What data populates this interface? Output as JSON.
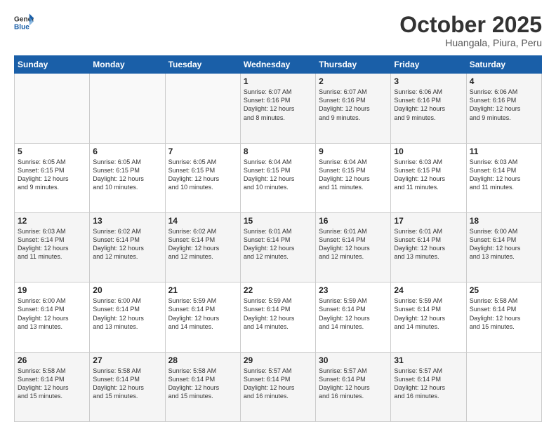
{
  "header": {
    "logo_line1": "General",
    "logo_line2": "Blue",
    "month": "October 2025",
    "location": "Huangala, Piura, Peru"
  },
  "weekdays": [
    "Sunday",
    "Monday",
    "Tuesday",
    "Wednesday",
    "Thursday",
    "Friday",
    "Saturday"
  ],
  "rows": [
    [
      {
        "day": "",
        "lines": []
      },
      {
        "day": "",
        "lines": []
      },
      {
        "day": "",
        "lines": []
      },
      {
        "day": "1",
        "lines": [
          "Sunrise: 6:07 AM",
          "Sunset: 6:16 PM",
          "Daylight: 12 hours",
          "and 8 minutes."
        ]
      },
      {
        "day": "2",
        "lines": [
          "Sunrise: 6:07 AM",
          "Sunset: 6:16 PM",
          "Daylight: 12 hours",
          "and 9 minutes."
        ]
      },
      {
        "day": "3",
        "lines": [
          "Sunrise: 6:06 AM",
          "Sunset: 6:16 PM",
          "Daylight: 12 hours",
          "and 9 minutes."
        ]
      },
      {
        "day": "4",
        "lines": [
          "Sunrise: 6:06 AM",
          "Sunset: 6:16 PM",
          "Daylight: 12 hours",
          "and 9 minutes."
        ]
      }
    ],
    [
      {
        "day": "5",
        "lines": [
          "Sunrise: 6:05 AM",
          "Sunset: 6:15 PM",
          "Daylight: 12 hours",
          "and 9 minutes."
        ]
      },
      {
        "day": "6",
        "lines": [
          "Sunrise: 6:05 AM",
          "Sunset: 6:15 PM",
          "Daylight: 12 hours",
          "and 10 minutes."
        ]
      },
      {
        "day": "7",
        "lines": [
          "Sunrise: 6:05 AM",
          "Sunset: 6:15 PM",
          "Daylight: 12 hours",
          "and 10 minutes."
        ]
      },
      {
        "day": "8",
        "lines": [
          "Sunrise: 6:04 AM",
          "Sunset: 6:15 PM",
          "Daylight: 12 hours",
          "and 10 minutes."
        ]
      },
      {
        "day": "9",
        "lines": [
          "Sunrise: 6:04 AM",
          "Sunset: 6:15 PM",
          "Daylight: 12 hours",
          "and 11 minutes."
        ]
      },
      {
        "day": "10",
        "lines": [
          "Sunrise: 6:03 AM",
          "Sunset: 6:15 PM",
          "Daylight: 12 hours",
          "and 11 minutes."
        ]
      },
      {
        "day": "11",
        "lines": [
          "Sunrise: 6:03 AM",
          "Sunset: 6:14 PM",
          "Daylight: 12 hours",
          "and 11 minutes."
        ]
      }
    ],
    [
      {
        "day": "12",
        "lines": [
          "Sunrise: 6:03 AM",
          "Sunset: 6:14 PM",
          "Daylight: 12 hours",
          "and 11 minutes."
        ]
      },
      {
        "day": "13",
        "lines": [
          "Sunrise: 6:02 AM",
          "Sunset: 6:14 PM",
          "Daylight: 12 hours",
          "and 12 minutes."
        ]
      },
      {
        "day": "14",
        "lines": [
          "Sunrise: 6:02 AM",
          "Sunset: 6:14 PM",
          "Daylight: 12 hours",
          "and 12 minutes."
        ]
      },
      {
        "day": "15",
        "lines": [
          "Sunrise: 6:01 AM",
          "Sunset: 6:14 PM",
          "Daylight: 12 hours",
          "and 12 minutes."
        ]
      },
      {
        "day": "16",
        "lines": [
          "Sunrise: 6:01 AM",
          "Sunset: 6:14 PM",
          "Daylight: 12 hours",
          "and 12 minutes."
        ]
      },
      {
        "day": "17",
        "lines": [
          "Sunrise: 6:01 AM",
          "Sunset: 6:14 PM",
          "Daylight: 12 hours",
          "and 13 minutes."
        ]
      },
      {
        "day": "18",
        "lines": [
          "Sunrise: 6:00 AM",
          "Sunset: 6:14 PM",
          "Daylight: 12 hours",
          "and 13 minutes."
        ]
      }
    ],
    [
      {
        "day": "19",
        "lines": [
          "Sunrise: 6:00 AM",
          "Sunset: 6:14 PM",
          "Daylight: 12 hours",
          "and 13 minutes."
        ]
      },
      {
        "day": "20",
        "lines": [
          "Sunrise: 6:00 AM",
          "Sunset: 6:14 PM",
          "Daylight: 12 hours",
          "and 13 minutes."
        ]
      },
      {
        "day": "21",
        "lines": [
          "Sunrise: 5:59 AM",
          "Sunset: 6:14 PM",
          "Daylight: 12 hours",
          "and 14 minutes."
        ]
      },
      {
        "day": "22",
        "lines": [
          "Sunrise: 5:59 AM",
          "Sunset: 6:14 PM",
          "Daylight: 12 hours",
          "and 14 minutes."
        ]
      },
      {
        "day": "23",
        "lines": [
          "Sunrise: 5:59 AM",
          "Sunset: 6:14 PM",
          "Daylight: 12 hours",
          "and 14 minutes."
        ]
      },
      {
        "day": "24",
        "lines": [
          "Sunrise: 5:59 AM",
          "Sunset: 6:14 PM",
          "Daylight: 12 hours",
          "and 14 minutes."
        ]
      },
      {
        "day": "25",
        "lines": [
          "Sunrise: 5:58 AM",
          "Sunset: 6:14 PM",
          "Daylight: 12 hours",
          "and 15 minutes."
        ]
      }
    ],
    [
      {
        "day": "26",
        "lines": [
          "Sunrise: 5:58 AM",
          "Sunset: 6:14 PM",
          "Daylight: 12 hours",
          "and 15 minutes."
        ]
      },
      {
        "day": "27",
        "lines": [
          "Sunrise: 5:58 AM",
          "Sunset: 6:14 PM",
          "Daylight: 12 hours",
          "and 15 minutes."
        ]
      },
      {
        "day": "28",
        "lines": [
          "Sunrise: 5:58 AM",
          "Sunset: 6:14 PM",
          "Daylight: 12 hours",
          "and 15 minutes."
        ]
      },
      {
        "day": "29",
        "lines": [
          "Sunrise: 5:57 AM",
          "Sunset: 6:14 PM",
          "Daylight: 12 hours",
          "and 16 minutes."
        ]
      },
      {
        "day": "30",
        "lines": [
          "Sunrise: 5:57 AM",
          "Sunset: 6:14 PM",
          "Daylight: 12 hours",
          "and 16 minutes."
        ]
      },
      {
        "day": "31",
        "lines": [
          "Sunrise: 5:57 AM",
          "Sunset: 6:14 PM",
          "Daylight: 12 hours",
          "and 16 minutes."
        ]
      },
      {
        "day": "",
        "lines": []
      }
    ]
  ]
}
